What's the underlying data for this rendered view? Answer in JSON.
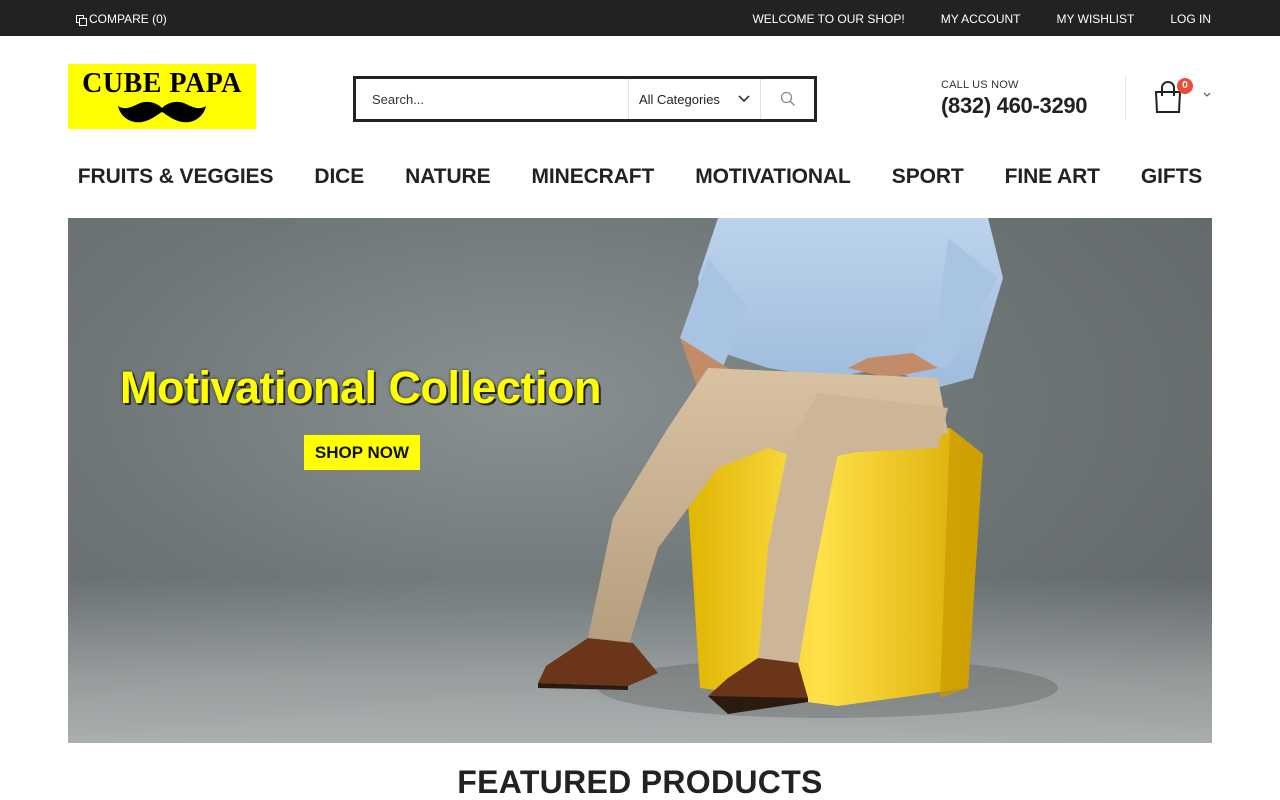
{
  "topbar": {
    "compare_label": "COMPARE (0)",
    "links": [
      "WELCOME TO OUR SHOP!",
      "MY ACCOUNT",
      "MY WISHLIST",
      "LOG IN"
    ]
  },
  "header": {
    "logo_text": "CUBE PAPA",
    "search": {
      "placeholder": "Search...",
      "category": "All Categories"
    },
    "call": {
      "label": "CALL US NOW",
      "number": "(832) 460-3290"
    },
    "cart": {
      "count": "0"
    }
  },
  "nav": {
    "items": [
      "FRUITS & VEGGIES",
      "DICE",
      "NATURE",
      "MINECRAFT",
      "MOTIVATIONAL",
      "SPORT",
      "FINE ART",
      "GIFTS"
    ]
  },
  "hero": {
    "title": "Motivational Collection",
    "button": "SHOP NOW"
  },
  "featured": {
    "title": "FEATURED PRODUCTS"
  },
  "colors": {
    "accent_yellow": "#ffff00",
    "topbar_bg": "#222222",
    "badge_red": "#e74c3c"
  },
  "icons": {
    "compare": "compare-icon",
    "search": "search-icon",
    "chevron": "chevron-down-icon",
    "cart": "shopping-bag-icon"
  }
}
